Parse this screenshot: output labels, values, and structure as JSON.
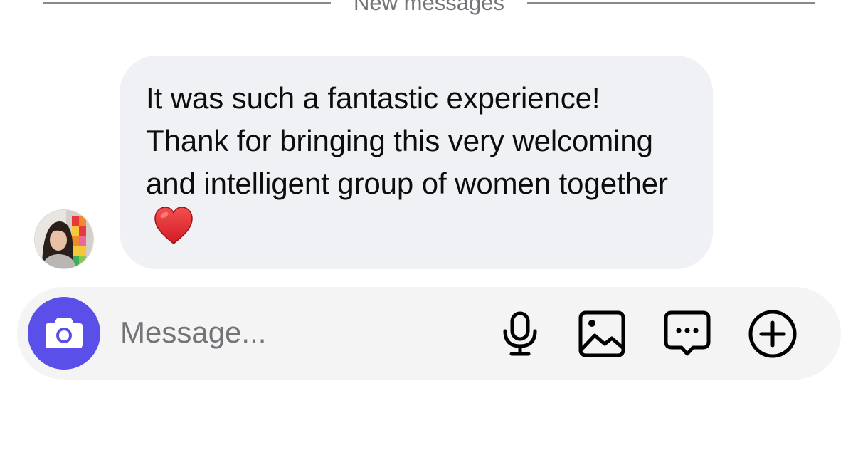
{
  "divider": {
    "label": "New messages"
  },
  "message": {
    "text": "It was such a fantastic experience! Thank for bringing this very welcoming and intelligent group of women together",
    "emoji_icon": "red-heart-icon"
  },
  "composer": {
    "placeholder": "Message...",
    "camera_icon": "camera-icon",
    "actions": [
      {
        "icon": "microphone-icon"
      },
      {
        "icon": "image-icon"
      },
      {
        "icon": "sticker-chat-icon"
      },
      {
        "icon": "plus-circle-icon"
      }
    ]
  },
  "colors": {
    "accent": "#5a4fe8",
    "bubble": "#eff1f4",
    "composer": "#f4f4f5",
    "muted_text": "#737378",
    "heart": "#e0242a"
  }
}
